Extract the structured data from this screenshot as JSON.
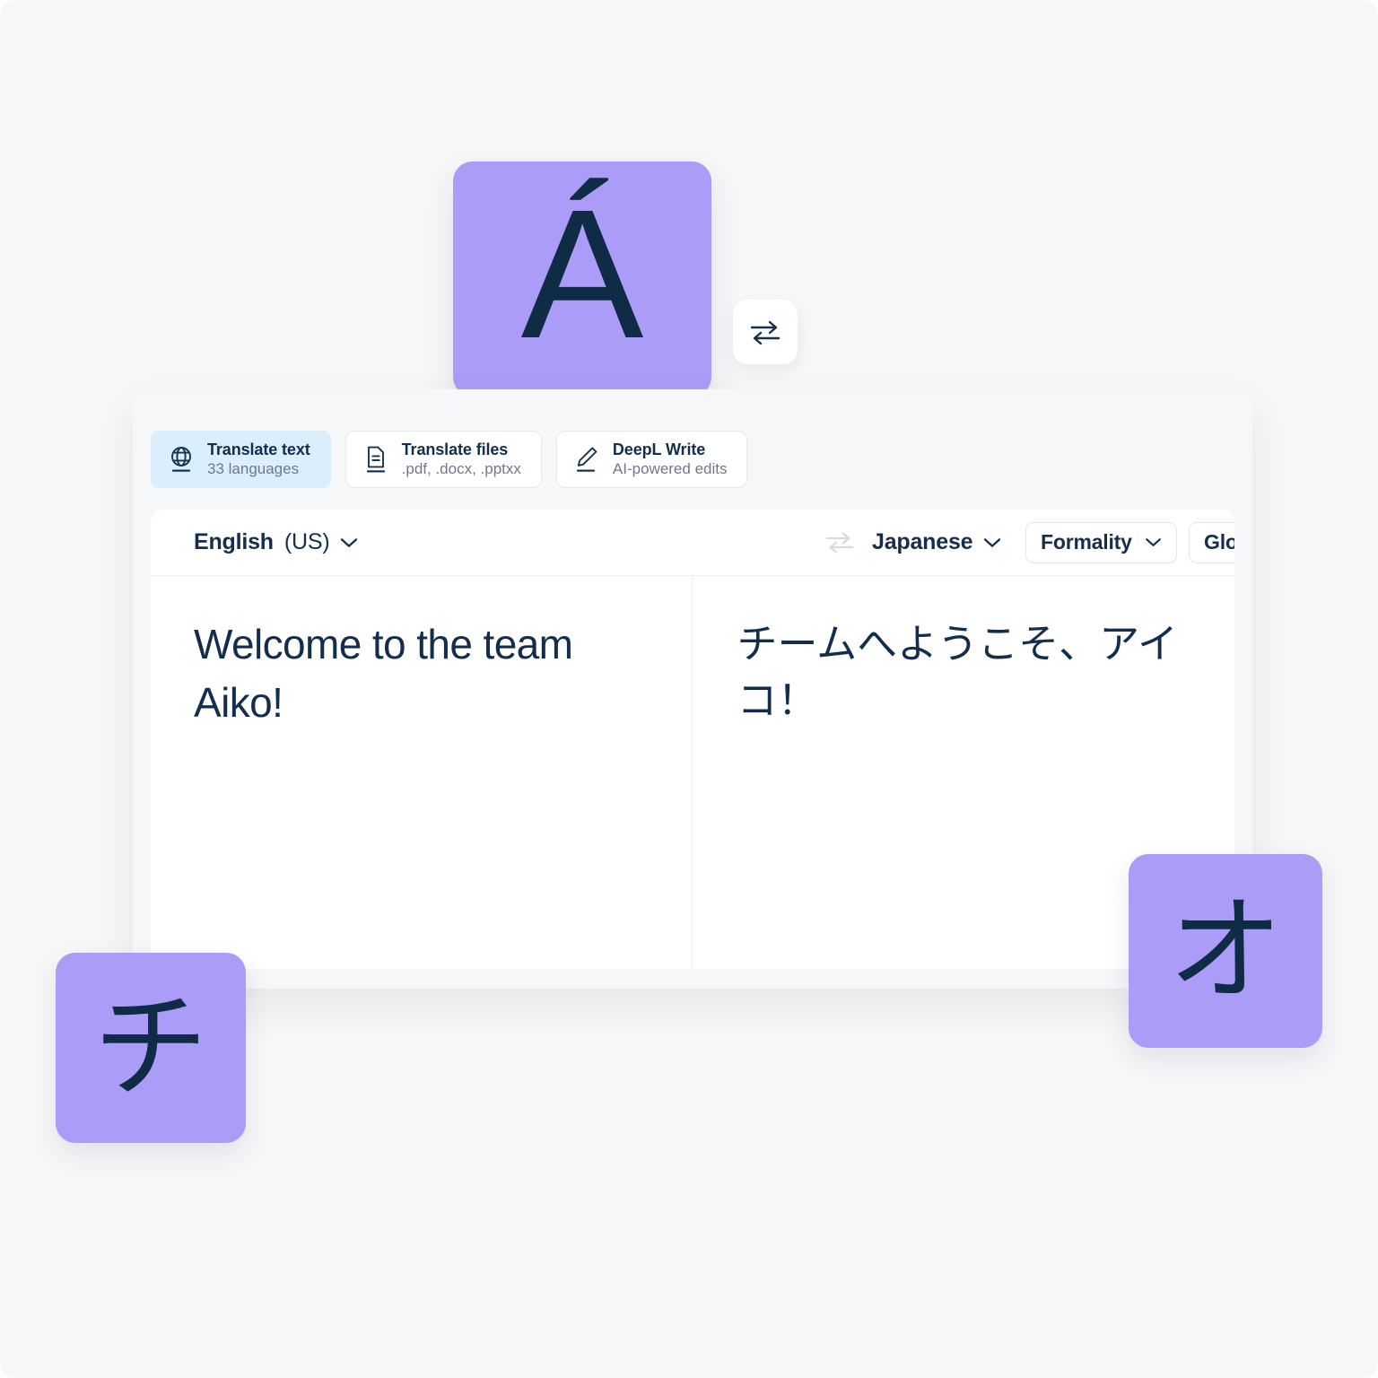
{
  "decor": {
    "tiles": [
      {
        "name": "accent-a-tile",
        "glyph": "Á"
      },
      {
        "name": "katakana-chi-tile",
        "glyph": "チ"
      },
      {
        "name": "katakana-o-tile",
        "glyph": "オ"
      }
    ],
    "purple": "#ab9cf7",
    "ink": "#0f2b46"
  },
  "floating_swap": {
    "icon": "swap-arrows-icon"
  },
  "tabs": [
    {
      "id": "translate-text",
      "icon": "globe-icon",
      "title": "Translate text",
      "subtitle": "33 languages",
      "active": true
    },
    {
      "id": "translate-files",
      "icon": "document-icon",
      "title": "Translate files",
      "subtitle": ".pdf, .docx, .pptxx",
      "active": false
    },
    {
      "id": "deepl-write",
      "icon": "pencil-icon",
      "title": "DeepL Write",
      "subtitle": "AI-powered edits",
      "active": false
    }
  ],
  "language_bar": {
    "source": {
      "name": "English",
      "variant": "(US)",
      "chevron": "chevron-down-icon"
    },
    "swap": {
      "icon": "swap-arrows-icon"
    },
    "target": {
      "name": "Japanese",
      "chevron": "chevron-down-icon"
    },
    "formality": {
      "label": "Formality",
      "chevron": "chevron-down-icon"
    },
    "glossary": {
      "label": "Glossary",
      "toggle_on": true,
      "toggle_color": "#2ad68f"
    }
  },
  "editor": {
    "source_text": "Welcome to the team Aiko!",
    "target_text": "チームへようこそ、アイコ！"
  }
}
